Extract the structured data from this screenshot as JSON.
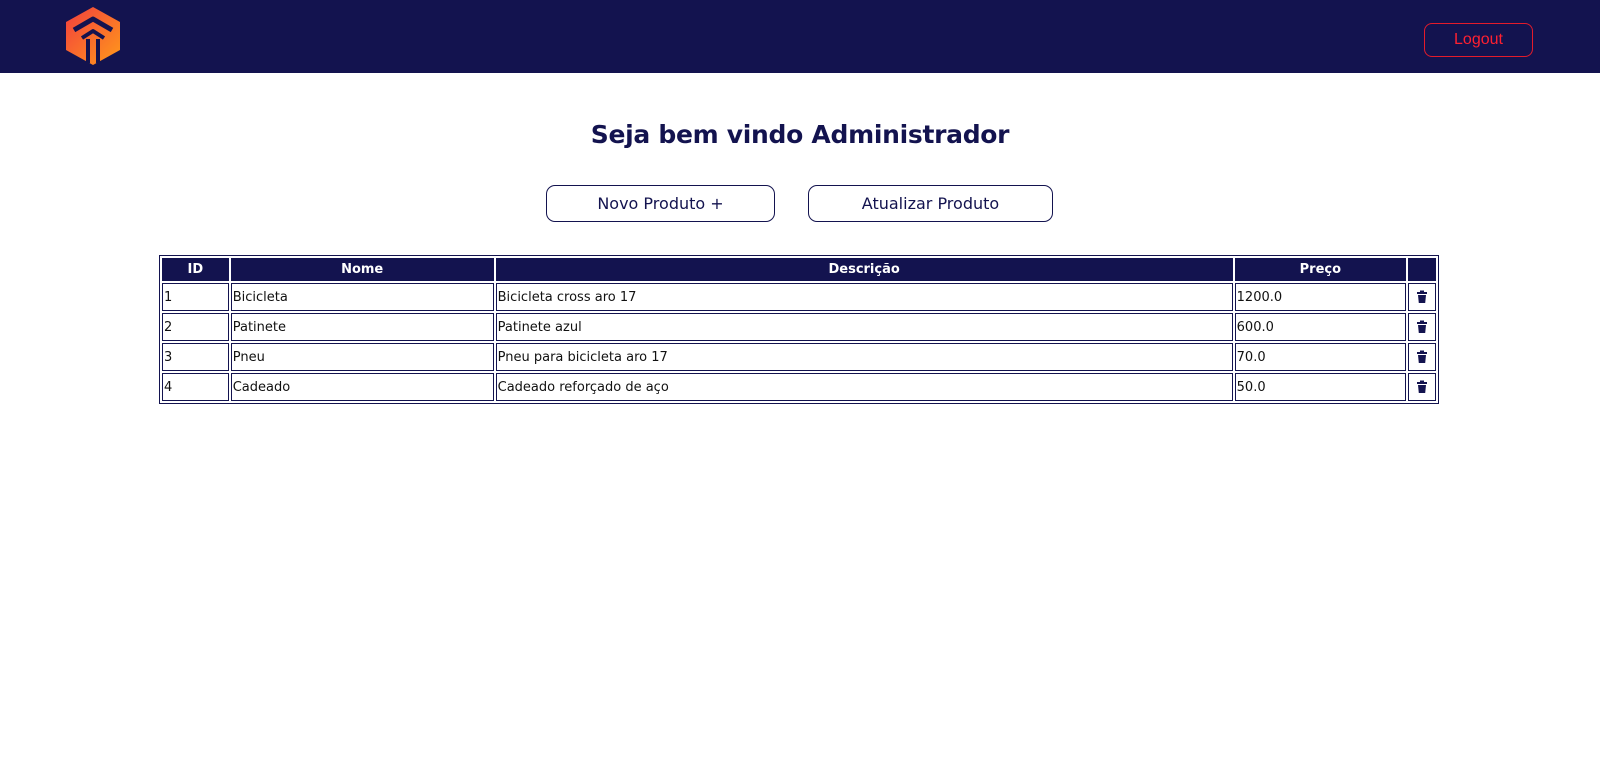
{
  "header": {
    "logo_icon": "house-arrow-logo-icon",
    "logout_label": "Logout",
    "brand_bg": "#13134f",
    "accent_red": "#ff2030",
    "logo_gradient": [
      "#f23e3e",
      "#ff9a1a"
    ]
  },
  "main": {
    "title": "Seja bem vindo Administrador",
    "new_product_label": "Novo Produto +",
    "update_product_label": "Atualizar Produto"
  },
  "table": {
    "headers": [
      "ID",
      "Nome",
      "Descrição",
      "Preço",
      ""
    ],
    "rows": [
      {
        "id": "1",
        "nome": "Bicicleta",
        "descricao": "Bicicleta cross aro 17",
        "preco": "1200.0",
        "action_icon": "trash-icon"
      },
      {
        "id": "2",
        "nome": "Patinete",
        "descricao": "Patinete azul",
        "preco": "600.0",
        "action_icon": "trash-icon"
      },
      {
        "id": "3",
        "nome": "Pneu",
        "descricao": "Pneu para bicicleta aro 17",
        "preco": "70.0",
        "action_icon": "trash-icon"
      },
      {
        "id": "4",
        "nome": "Cadeado",
        "descricao": "Cadeado reforçado de aço",
        "preco": "50.0",
        "action_icon": "trash-icon"
      }
    ]
  }
}
